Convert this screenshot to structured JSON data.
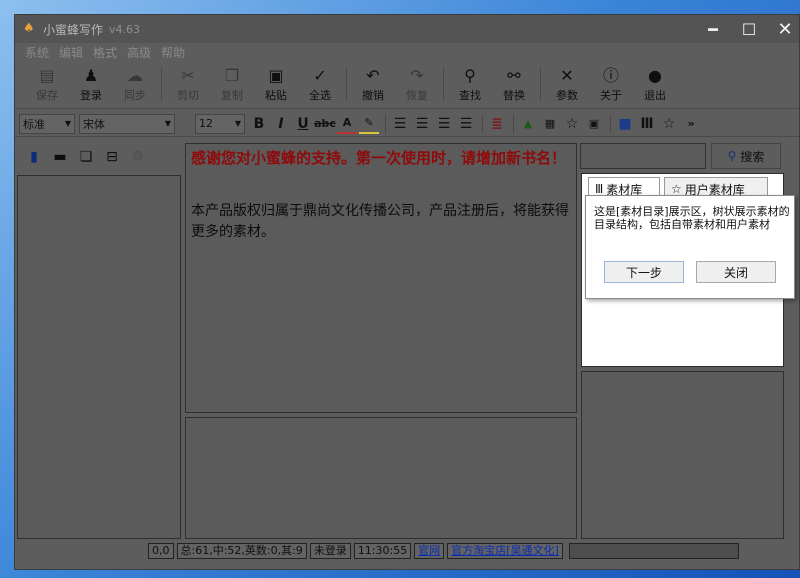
{
  "window": {
    "title": "小蜜蜂写作",
    "version": "v4.63"
  },
  "menu": [
    "系统",
    "编辑",
    "格式",
    "高级",
    "帮助"
  ],
  "toolbar": [
    {
      "label": "保存",
      "icon": "save-icon",
      "glyph": "▤",
      "dim": true
    },
    {
      "label": "登录",
      "icon": "user-icon",
      "glyph": "♟",
      "dim": false
    },
    {
      "label": "同步",
      "icon": "cloud-icon",
      "glyph": "☁",
      "dim": true
    },
    {
      "label": "剪切",
      "icon": "scissors-icon",
      "glyph": "✂",
      "dim": true
    },
    {
      "label": "复制",
      "icon": "copy-icon",
      "glyph": "❐",
      "dim": true
    },
    {
      "label": "粘贴",
      "icon": "paste-icon",
      "glyph": "▣",
      "dim": false
    },
    {
      "label": "全选",
      "icon": "check-all-icon",
      "glyph": "✓",
      "dim": false
    },
    {
      "label": "撤销",
      "icon": "undo-icon",
      "glyph": "↶",
      "dim": false
    },
    {
      "label": "恢复",
      "icon": "redo-icon",
      "glyph": "↷",
      "dim": true
    },
    {
      "label": "查找",
      "icon": "search-icon",
      "glyph": "⚲",
      "dim": false
    },
    {
      "label": "替换",
      "icon": "replace-icon",
      "glyph": "⚯",
      "dim": false
    },
    {
      "label": "参数",
      "icon": "tools-icon",
      "glyph": "✕",
      "dim": false
    },
    {
      "label": "关于",
      "icon": "info-icon",
      "glyph": "ⓘ",
      "dim": false
    },
    {
      "label": "退出",
      "icon": "exit-icon",
      "glyph": "●",
      "dim": false
    }
  ],
  "format": {
    "style": "标准",
    "font": "宋体",
    "size": "12"
  },
  "main": {
    "welcome": "感谢您对小蜜蜂的支持。第一次使用时，请增加新书名！",
    "copyright": "本产品版权归属于鼎尚文化传播公司，产品注册后，将能获得更多的素材。"
  },
  "search": {
    "label": "搜索"
  },
  "tabs": [
    {
      "label": "素材库"
    },
    {
      "label": "用户素材库"
    }
  ],
  "tooltip": {
    "message": "这是[素材目录]展示区，树状展示素材的目录结构，包括自带素材和用户素材",
    "next": "下一步",
    "close": "关闭"
  },
  "status": {
    "cursor": "0,0",
    "counts": "总:61,中:52,英数:0,其:9",
    "login": "未登录",
    "time": "11:30:55",
    "site": "官网",
    "shop": "官方淘宝店[昊通文化]"
  },
  "colors": {
    "accent_blue": "#1d5fd6",
    "welcome_red": "#8f0a0a",
    "link_blue": "#0b2db0"
  }
}
